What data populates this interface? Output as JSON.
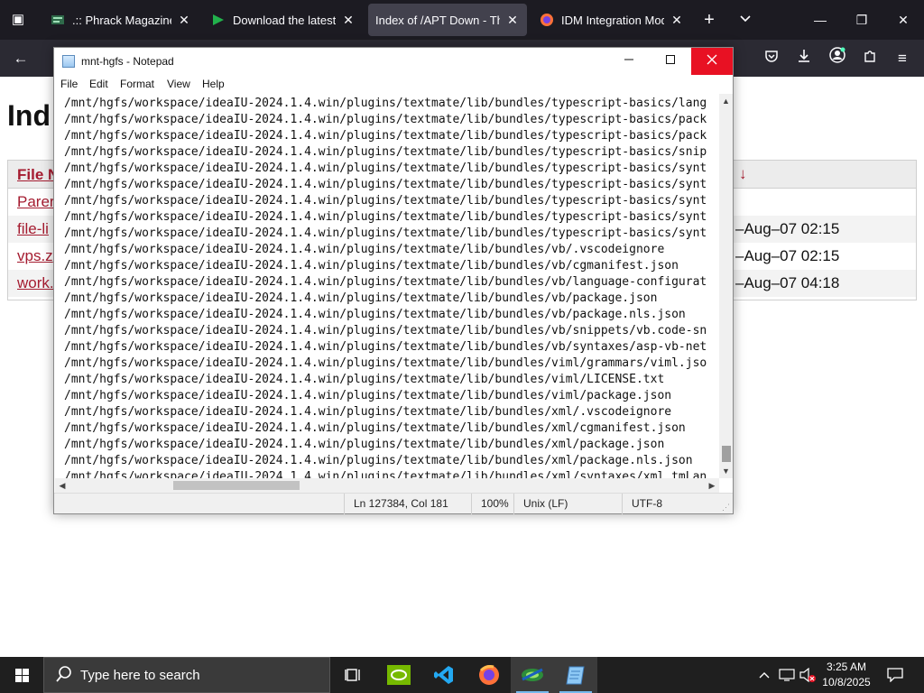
{
  "browser": {
    "tabs": [
      {
        "title": ".:: Phrack Magazine ::.",
        "icon": "phrack-icon",
        "active": false
      },
      {
        "title": "Download the latest free",
        "icon": "download-flag-icon",
        "active": false
      },
      {
        "title": "Index of /APT Down - The North",
        "icon": "none",
        "active": true
      },
      {
        "title": "IDM Integration Module",
        "icon": "firefox-icon",
        "active": false
      }
    ],
    "tab_close_glyph": "✕",
    "new_tab_glyph": "+",
    "list_tabs_glyph": "⌄",
    "window_min": "—",
    "window_max": "❐",
    "window_close": "✕"
  },
  "page": {
    "title": "Ind",
    "header_name": "File N",
    "header_date_arrow": "↓",
    "rows": [
      {
        "name": "Parer",
        "date": ""
      },
      {
        "name": "file-li",
        "date": "–Aug–07 02:15"
      },
      {
        "name": "vps.z",
        "date": "–Aug–07 02:15"
      },
      {
        "name": "work.",
        "date": "–Aug–07 04:18"
      }
    ]
  },
  "notepad": {
    "title": "mnt-hgfs - Notepad",
    "menu": [
      "File",
      "Edit",
      "Format",
      "View",
      "Help"
    ],
    "lines": [
      "/mnt/hgfs/workspace/ideaIU-2024.1.4.win/plugins/textmate/lib/bundles/typescript-basics/lang",
      "/mnt/hgfs/workspace/ideaIU-2024.1.4.win/plugins/textmate/lib/bundles/typescript-basics/pack",
      "/mnt/hgfs/workspace/ideaIU-2024.1.4.win/plugins/textmate/lib/bundles/typescript-basics/pack",
      "/mnt/hgfs/workspace/ideaIU-2024.1.4.win/plugins/textmate/lib/bundles/typescript-basics/snip",
      "/mnt/hgfs/workspace/ideaIU-2024.1.4.win/plugins/textmate/lib/bundles/typescript-basics/synt",
      "/mnt/hgfs/workspace/ideaIU-2024.1.4.win/plugins/textmate/lib/bundles/typescript-basics/synt",
      "/mnt/hgfs/workspace/ideaIU-2024.1.4.win/plugins/textmate/lib/bundles/typescript-basics/synt",
      "/mnt/hgfs/workspace/ideaIU-2024.1.4.win/plugins/textmate/lib/bundles/typescript-basics/synt",
      "/mnt/hgfs/workspace/ideaIU-2024.1.4.win/plugins/textmate/lib/bundles/typescript-basics/synt",
      "/mnt/hgfs/workspace/ideaIU-2024.1.4.win/plugins/textmate/lib/bundles/vb/.vscodeignore",
      "/mnt/hgfs/workspace/ideaIU-2024.1.4.win/plugins/textmate/lib/bundles/vb/cgmanifest.json",
      "/mnt/hgfs/workspace/ideaIU-2024.1.4.win/plugins/textmate/lib/bundles/vb/language-configurat",
      "/mnt/hgfs/workspace/ideaIU-2024.1.4.win/plugins/textmate/lib/bundles/vb/package.json",
      "/mnt/hgfs/workspace/ideaIU-2024.1.4.win/plugins/textmate/lib/bundles/vb/package.nls.json",
      "/mnt/hgfs/workspace/ideaIU-2024.1.4.win/plugins/textmate/lib/bundles/vb/snippets/vb.code-sn",
      "/mnt/hgfs/workspace/ideaIU-2024.1.4.win/plugins/textmate/lib/bundles/vb/syntaxes/asp-vb-net",
      "/mnt/hgfs/workspace/ideaIU-2024.1.4.win/plugins/textmate/lib/bundles/viml/grammars/viml.jso",
      "/mnt/hgfs/workspace/ideaIU-2024.1.4.win/plugins/textmate/lib/bundles/viml/LICENSE.txt",
      "/mnt/hgfs/workspace/ideaIU-2024.1.4.win/plugins/textmate/lib/bundles/viml/package.json",
      "/mnt/hgfs/workspace/ideaIU-2024.1.4.win/plugins/textmate/lib/bundles/xml/.vscodeignore",
      "/mnt/hgfs/workspace/ideaIU-2024.1.4.win/plugins/textmate/lib/bundles/xml/cgmanifest.json",
      "/mnt/hgfs/workspace/ideaIU-2024.1.4.win/plugins/textmate/lib/bundles/xml/package.json",
      "/mnt/hgfs/workspace/ideaIU-2024.1.4.win/plugins/textmate/lib/bundles/xml/package.nls.json",
      "/mnt/hgfs/workspace/ideaIU-2024.1.4.win/plugins/textmate/lib/bundles/xml/syntaxes/xml.tmLan"
    ],
    "status": {
      "position": "Ln 127384, Col 181",
      "zoom": "100%",
      "line_ending": "Unix (LF)",
      "encoding": "UTF-8"
    }
  },
  "taskbar": {
    "search_placeholder": "Type here to search",
    "apps": [
      {
        "name": "task-view-icon",
        "active": false
      },
      {
        "name": "nvidia-icon",
        "active": false
      },
      {
        "name": "vscode-icon",
        "active": false
      },
      {
        "name": "firefox-icon",
        "active": false
      },
      {
        "name": "network-app-icon",
        "active": true
      },
      {
        "name": "notepad-icon",
        "active": true
      }
    ],
    "time": "3:25 AM",
    "date": "10/8/2025"
  },
  "colors": {
    "link": "#a51c30",
    "browser_bg": "#1c1b22",
    "active_tab": "#42414d",
    "close_red": "#e81123",
    "taskbar_bg": "#1f1f1f"
  }
}
